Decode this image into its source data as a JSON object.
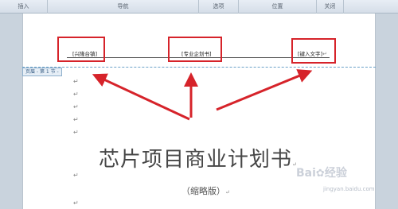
{
  "ribbon": {
    "groups": [
      {
        "label": "插入"
      },
      {
        "label": "导航"
      },
      {
        "label": "选项"
      },
      {
        "label": "位置"
      },
      {
        "label": "关闭"
      }
    ]
  },
  "header": {
    "tag_label": "页眉 - 第 1 节 -",
    "left_field": "[兴隆台镇]",
    "center_field": "[专业企划书]",
    "right_field": "[键入文字]"
  },
  "marks": {
    "paragraph": "↵"
  },
  "document": {
    "title": "芯片项目商业计划书",
    "subtitle": "（缩略版）"
  },
  "watermark": {
    "brand": "Bai",
    "brand_suffix": "经验",
    "url": "jingyan.baidu.com"
  },
  "colors": {
    "annotation_red": "#d6232a",
    "header_dash": "#69a0c8"
  }
}
